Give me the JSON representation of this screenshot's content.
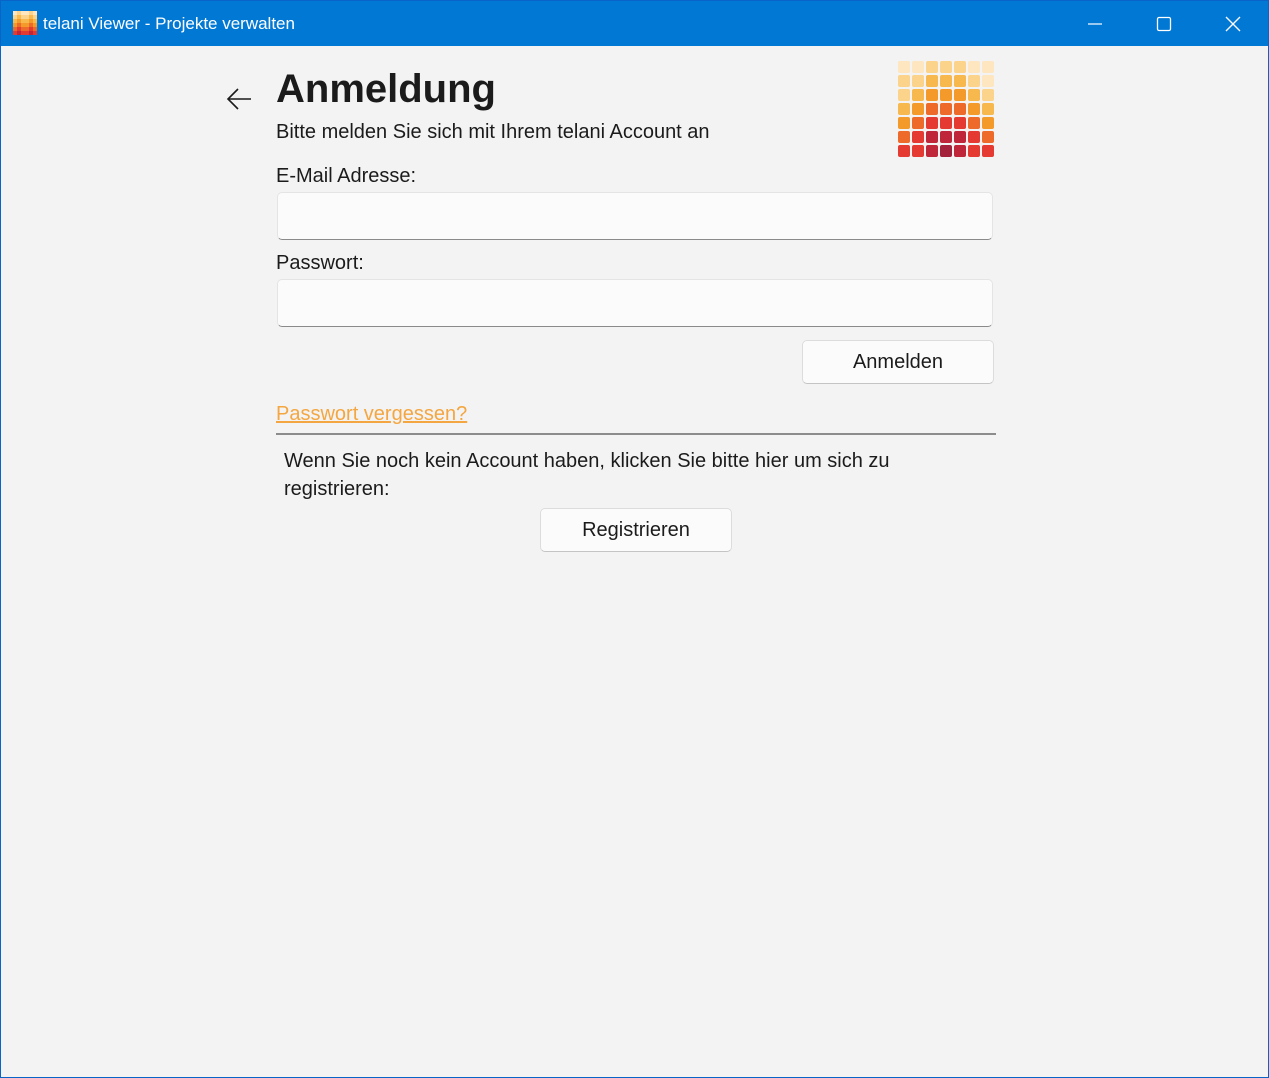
{
  "window": {
    "title": "telani Viewer - Projekte verwalten",
    "icons": {
      "app": "telani-app-icon",
      "minimize": "minimize-icon",
      "maximize": "maximize-icon",
      "close": "close-icon"
    }
  },
  "page": {
    "back_icon": "back-arrow-icon",
    "heading": "Anmeldung",
    "subtitle": "Bitte melden Sie sich mit Ihrem telani Account an",
    "logo": "telani-logo"
  },
  "form": {
    "email_label": "E-Mail Adresse:",
    "email_value": "",
    "password_label": "Passwort:",
    "password_value": "",
    "login_button": "Anmelden",
    "forgot_link": "Passwort vergessen?"
  },
  "register": {
    "info_text": "Wenn Sie noch kein Account haben, klicken Sie bitte hier um sich zu registrieren:",
    "button": "Registrieren"
  },
  "colors": {
    "titlebar": "#0078d4",
    "background": "#f3f3f3",
    "link": "#f4a640",
    "logo_palette": [
      "#fde6c0",
      "#fbd38a",
      "#f7b84e",
      "#f39a2a",
      "#ee6a2a",
      "#e53a32",
      "#c0263a",
      "#a3213a"
    ]
  }
}
